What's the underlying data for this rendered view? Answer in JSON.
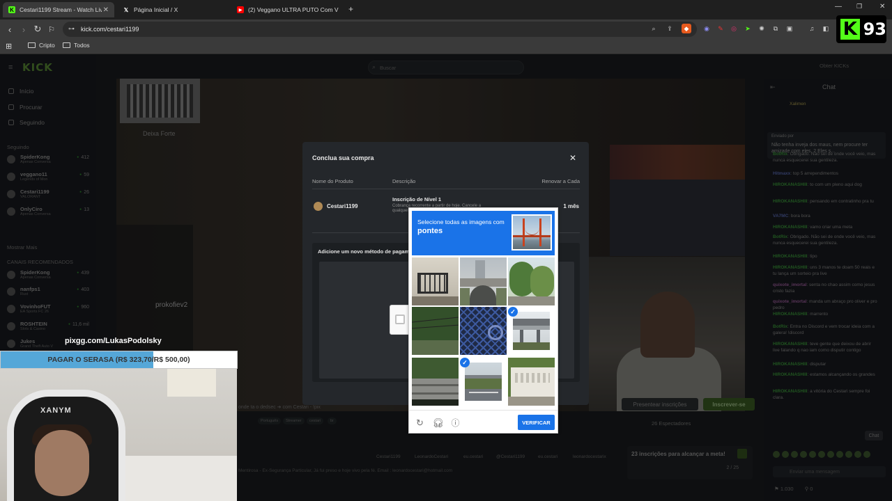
{
  "browser": {
    "tabs": [
      {
        "title": "Cestari1199 Stream - Watch Live",
        "active": true
      },
      {
        "title": "Página Inicial / X",
        "active": false
      },
      {
        "title": "(2) Veggano ULTRA PUTO Com Views",
        "active": false
      }
    ],
    "url": "kick.com/cestari1199",
    "bookmarks": [
      "Cripto",
      "Todos"
    ],
    "badge_letter": "K",
    "badge_number": "93"
  },
  "kick": {
    "logo": "KICK",
    "search_placeholder": "Buscar",
    "obtain_kicks": "Obter KICKs",
    "nav": [
      "Início",
      "Procurar",
      "Seguindo"
    ],
    "following_title": "Seguindo",
    "following": [
      {
        "name": "SpiderKong",
        "category": "Apenas Conversa",
        "viewers": "412"
      },
      {
        "name": "veggano11",
        "category": "Legends of Mon",
        "viewers": "59"
      },
      {
        "name": "Cestari1199",
        "category": "VALORANT",
        "viewers": "26"
      },
      {
        "name": "OnlyCiro",
        "category": "Apenas Conversa",
        "viewers": "13"
      }
    ],
    "show_more": "Mostrar Mais",
    "recommended_title": "CANAIS RECOMENDADOS",
    "recommended": [
      {
        "name": "SpiderKong",
        "category": "Apenas Conversa",
        "viewers": "439"
      },
      {
        "name": "nanfps1",
        "category": "Rust",
        "viewers": "403"
      },
      {
        "name": "VovinhoFUT",
        "category": "EA Sports FC 26",
        "viewers": "960"
      },
      {
        "name": "ROSHTEIN",
        "category": "Slots & Casino",
        "viewers": "11,6 mil"
      },
      {
        "name": "Jukes",
        "category": "Grand Theft Auto V",
        "viewers": ""
      }
    ],
    "stream_overlay": {
      "qr_caption": "Deixa Forte",
      "streamer_name": "prokofiev2"
    },
    "stream_title": "onde ta o dedsec ➜ com Cestari - !pix",
    "tags": [
      "Português",
      "Streamer",
      "cestari",
      "br"
    ],
    "present_button": "Presentear inscrições",
    "subscribe_button": "Inscrever-se",
    "watching": "26 Espectadores",
    "socials": [
      "Cestari1199",
      "LeonardoCestari",
      "eu.cestari",
      "@Cestari1199",
      "eu.cestari",
      "leonardocestarix"
    ],
    "bio": "Mentirosa - Ex-Segurança Particular, Já fui preso e hoje vivo pela fé. Email : leonardocestari@hotmail.com",
    "goal": {
      "text": "23 inscrições para alcançar a meta!",
      "count": "2 / 25"
    }
  },
  "chat": {
    "title": "Chat",
    "pinned_header": "Enviado por",
    "pinned_text": "Não tenha inveja dos maus, nem procure ter amizade com eles. 2 Eles s...",
    "top_user": "Xalimen",
    "messages": [
      {
        "user": "BotRix",
        "text": "Obrigado. Não sei de onde você veio, mas nunca esquecerei sua gentileza."
      },
      {
        "user": "Hitmaxx",
        "text": "top 5 arrependimentos"
      },
      {
        "user": "HIROKANASHIII",
        "text": "to com um pleno aqui dog"
      },
      {
        "user": "HIROKANASHIII",
        "text": "pensando em contratinho pra tu"
      },
      {
        "user": "VA7MC",
        "text": "bora bora"
      },
      {
        "user": "HIROKANASHIII",
        "text": "vamo criar uma meta"
      },
      {
        "user": "BotRix",
        "text": "Obrigado. Não sei de onde você veio, mas nunca esquecerei sua gentileza."
      },
      {
        "user": "HIROKANASHIII",
        "text": "tipo"
      },
      {
        "user": "HIROKANASHIII",
        "text": "uns 3 manos te doam 50 reais e tu lança um sorteio pra live"
      },
      {
        "user": "quixote_imortal",
        "text": "senta no chao assim como jesus cristo fazia"
      },
      {
        "user": "quixote_imortal",
        "text": "manda um abraço pro oliver e pro pedro"
      },
      {
        "user": "HIROKANASHIII",
        "text": "marrento"
      },
      {
        "user": "BotRix",
        "text": "Entra no Discord e vem trocar ideia com a galera! !discord"
      },
      {
        "user": "HIROKANASHIII",
        "text": "teve gente que deixou de abrir live falando q nao iam como disputir contigo"
      },
      {
        "user": "HIROKANASHIII",
        "text": "disputar"
      },
      {
        "user": "HIROKANASHIII",
        "text": "estamos alcançando os grandes"
      },
      {
        "user": "HIROKANASHIII",
        "text": "a vitória do Cestari sempre foi clara."
      }
    ],
    "input_placeholder": "Enviar uma mensagem",
    "kicks": "1.030",
    "zero": "0",
    "send": "Chat"
  },
  "purchase_modal": {
    "title": "Conclua sua compra",
    "col_product": "Nome do Produto",
    "col_description": "Descrição",
    "col_renew": "Renovar a Cada",
    "product": "Cestari1199",
    "desc_title": "Inscrição de Nível 1",
    "desc_text": "Cobrança recorrente a partir de hoje. Cancele a qualquer momento.",
    "renew": "1 mês",
    "payment_title": "Adicione um novo método de pagamento"
  },
  "captcha": {
    "instruction": "Selecione todas as imagens com",
    "keyword": "pontes",
    "tiles": [
      {
        "content": "building-balcony",
        "selected": false
      },
      {
        "content": "overpass-with-tunnel",
        "selected": false
      },
      {
        "content": "trees-and-shrubs",
        "selected": false
      },
      {
        "content": "trees-with-power-lines",
        "selected": false
      },
      {
        "content": "blue-fence",
        "selected": false
      },
      {
        "content": "elevated-overpass",
        "selected": true
      },
      {
        "content": "concrete-bridge-structure",
        "selected": false
      },
      {
        "content": "bridge-road",
        "selected": true
      },
      {
        "content": "white-wall-with-plants",
        "selected": false
      }
    ],
    "verify": "VERIFICAR"
  },
  "overlay": {
    "pix_text": "pixgg.com/LukasPodolsky",
    "goal_text": "PAGAR O SERASA (R$ 323,70/R$ 500,00)",
    "goal_progress": 0.6474,
    "webcam_brand": "XANYM"
  },
  "colors": {
    "kick_green": "#53fc18",
    "captcha_blue": "#1a73e8",
    "progress_blue": "#55a7d8"
  }
}
